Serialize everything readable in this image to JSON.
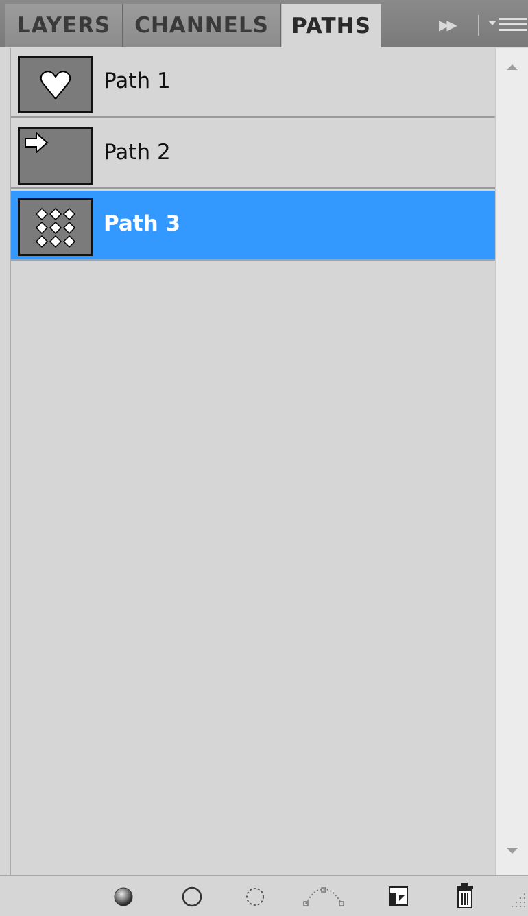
{
  "tabs": [
    {
      "label": "LAYERS",
      "active": false
    },
    {
      "label": "CHANNELS",
      "active": false
    },
    {
      "label": "PATHS",
      "active": true
    }
  ],
  "paths": [
    {
      "name": "Path 1",
      "thumbnail": "heart-shape",
      "selected": false
    },
    {
      "name": "Path 2",
      "thumbnail": "arrow-shape",
      "selected": false
    },
    {
      "name": "Path 3",
      "thumbnail": "diamond-grid-shape",
      "selected": true
    }
  ],
  "toolbar": {
    "icons": [
      "fill-path-icon",
      "stroke-path-icon",
      "load-selection-icon",
      "make-work-path-icon",
      "new-path-icon",
      "delete-path-icon"
    ]
  },
  "colors": {
    "selection": "#3399ff",
    "panel_bg": "#d6d6d6",
    "tab_bar": "#7f7f7f",
    "thumbnail_bg": "#7b7b7b"
  }
}
